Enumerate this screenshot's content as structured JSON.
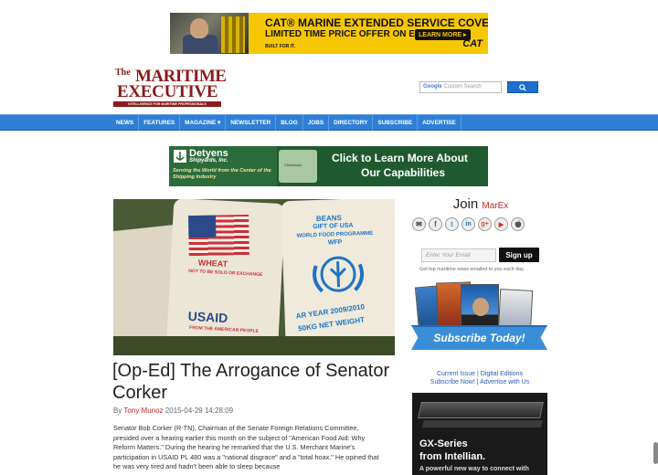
{
  "ads": {
    "top": {
      "line1": "CAT® MARINE EXTENDED SERVICE COVERAGE (ESC)",
      "line2": "LIMITED TIME PRICE OFFER ON ESC",
      "button": "LEARN MORE ▸",
      "line3": "BUILT FOR IT.",
      "brand": "CAT"
    },
    "mid": {
      "brand": "Detyens",
      "brand_sub": "Shipyards, Inc.",
      "tagline": "Serving the World from the Center of the Shipping Industry",
      "map_label": "Charleston",
      "cta_line1": "Click to Learn More About",
      "cta_line2": "Our Capabilities"
    },
    "side": {
      "line1": "GX-Series",
      "line2": "from Intellian.",
      "line3": "A powerful new way to connect with"
    }
  },
  "logo": {
    "the": "The",
    "word1": "MARITIME",
    "word2": "EXECUTIVE",
    "tagline": "INTELLIGENCE FOR MARITIME PROFESSIONALS"
  },
  "search": {
    "google": "Google",
    "placeholder": "Custom Search"
  },
  "nav": [
    "NEWS",
    "FEATURES",
    "MAGAZINE ▾",
    "NEWSLETTER",
    "BLOG",
    "JOBS",
    "DIRECTORY",
    "SUBSCRIBE",
    "ADVERTISE"
  ],
  "article": {
    "image_text": {
      "wheat": "WHEAT",
      "not_sold": "NOT TO BE SOLD OR EXCHANGE",
      "usaid": "USAID",
      "from_people": "FROM THE AMERICAN PEOPLE",
      "beans": "BEANS",
      "gift": "GIFT OF USA",
      "wfp_program": "WORLD FOOD PROGRAMME",
      "wfp": "WFP",
      "year": "AR YEAR 2009/2010",
      "net": "50KG NET WEIGHT"
    },
    "title": "[Op-Ed] The Arrogance of Senator Corker",
    "by": "By",
    "author": "Tony Munoz",
    "date": "2015-04-29 14:28:09",
    "body": "Senator Bob Corker (R-TN), Chairman of the Senate Foreign Relations Committee, presided over a hearing earlier this month on the subject of \"American Food Aid: Why Reform Matters.\" During the hearing he remarked that the U.S. Merchant Marine's participation in USAID PL 480 was a \"national disgrace\" and a \"total hoax.\" He opined that he was very tired and hadn't been able to sleep because"
  },
  "sidebar": {
    "join": "Join",
    "marex": "MarEx",
    "social": [
      {
        "icon": "email-icon",
        "glyph": "✉"
      },
      {
        "icon": "facebook-icon",
        "glyph": "f"
      },
      {
        "icon": "twitter-icon",
        "glyph": "t"
      },
      {
        "icon": "linkedin-icon",
        "glyph": "in"
      },
      {
        "icon": "googleplus-icon",
        "glyph": "g+"
      },
      {
        "icon": "youtube-icon",
        "glyph": "▶"
      },
      {
        "icon": "apple-icon",
        "glyph": ""
      }
    ],
    "email_placeholder": "Enter Your Email",
    "signup": "Sign up",
    "signup_note": "Get top maritime news emailed to you each day.",
    "subscribe_banner": "Subscribe Today!",
    "links_line1": "Current Issue | Digital Editions",
    "links_line2": "Subscribe Now! | Advertise with Us"
  },
  "colors": {
    "nav": "#2f7fd6",
    "brand_red": "#c0282d",
    "cat_yellow": "#f6c700"
  }
}
